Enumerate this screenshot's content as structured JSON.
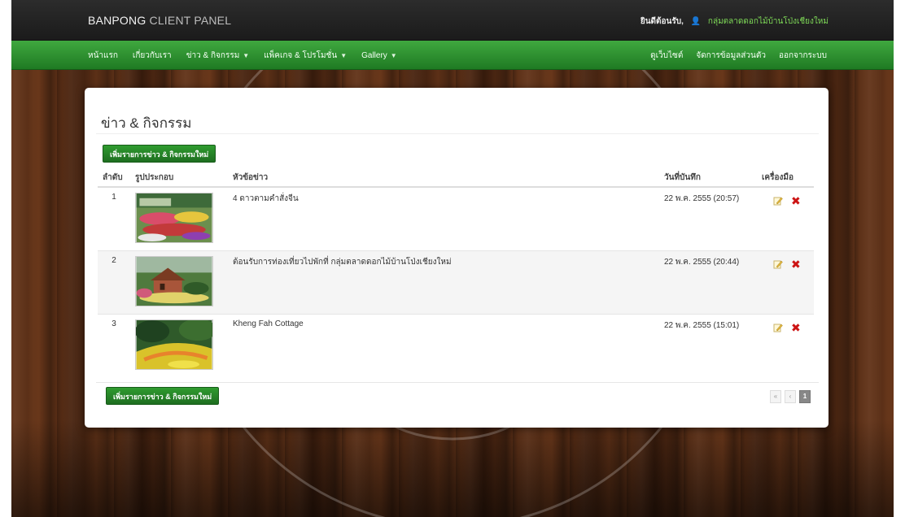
{
  "topbar": {
    "brand_main": "BANPONG",
    "brand_sub": "CLIENT PANEL",
    "welcome": "ยินดีต้อนรับ,",
    "username": "กลุ่มตลาดดอกไม้บ้านโป่งเชียงใหม่"
  },
  "nav": {
    "left": [
      {
        "label": "หน้าแรก",
        "caret": false
      },
      {
        "label": "เกี่ยวกับเรา",
        "caret": false
      },
      {
        "label": "ข่าว & กิจกรรม",
        "caret": true
      },
      {
        "label": "แพ็คเกจ & โปรโมชั่น",
        "caret": true
      },
      {
        "label": "Gallery",
        "caret": true
      }
    ],
    "right": [
      {
        "label": "ดูเว็บไซต์"
      },
      {
        "label": "จัดการข้อมูลส่วนตัว"
      },
      {
        "label": "ออกจากระบบ"
      }
    ]
  },
  "page": {
    "title": "ข่าว & กิจกรรม",
    "add_button": "เพิ่มรายการข่าว & กิจกรรมใหม่"
  },
  "table": {
    "headers": [
      "ลำดับ",
      "รูปประกอบ",
      "หัวข้อข่าว",
      "วันที่บันทึก",
      "เครื่องมือ"
    ],
    "rows": [
      {
        "no": "1",
        "title": "4 ดาวตามคำสั่งจีน",
        "date": "22 พ.ค. 2555 (20:57)",
        "thumb": "flower-garden"
      },
      {
        "no": "2",
        "title": "ต้อนรับการท่องเที่ยวไปพักที่ กลุ่มตลาดดอกไม้บ้านโป่งเชียงใหม่",
        "date": "22 พ.ค. 2555 (20:44)",
        "thumb": "garden-house"
      },
      {
        "no": "3",
        "title": "Kheng Fah Cottage",
        "date": "22 พ.ค. 2555 (15:01)",
        "thumb": "yellow-flowers"
      }
    ]
  },
  "pager": {
    "prev": "«",
    "prev2": "‹",
    "current": "1"
  },
  "colors": {
    "green": "#2f9b2f",
    "delete": "#cc1414",
    "topbar": "#1f1f1f"
  }
}
